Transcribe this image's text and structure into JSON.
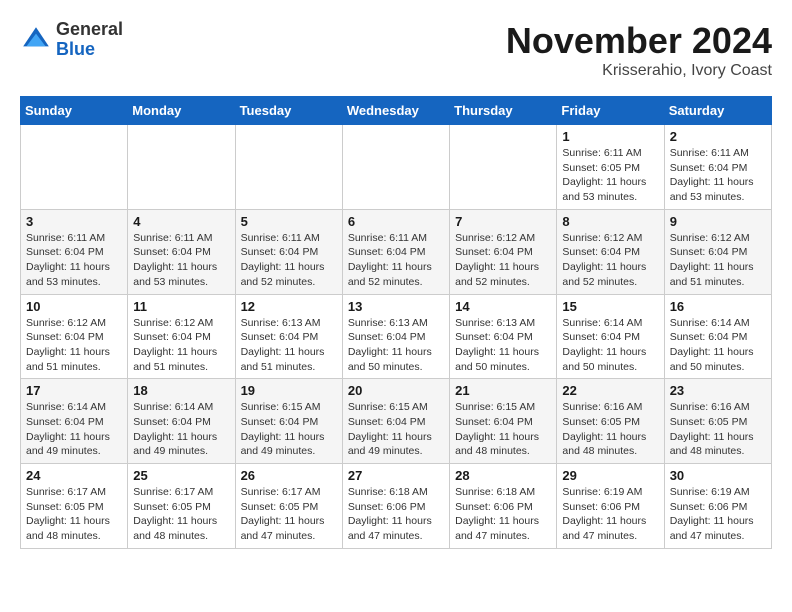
{
  "logo": {
    "line1": "General",
    "line2": "Blue"
  },
  "title": "November 2024",
  "subtitle": "Krisserahio, Ivory Coast",
  "weekdays": [
    "Sunday",
    "Monday",
    "Tuesday",
    "Wednesday",
    "Thursday",
    "Friday",
    "Saturday"
  ],
  "weeks": [
    [
      {
        "day": "",
        "info": ""
      },
      {
        "day": "",
        "info": ""
      },
      {
        "day": "",
        "info": ""
      },
      {
        "day": "",
        "info": ""
      },
      {
        "day": "",
        "info": ""
      },
      {
        "day": "1",
        "info": "Sunrise: 6:11 AM\nSunset: 6:05 PM\nDaylight: 11 hours and 53 minutes."
      },
      {
        "day": "2",
        "info": "Sunrise: 6:11 AM\nSunset: 6:04 PM\nDaylight: 11 hours and 53 minutes."
      }
    ],
    [
      {
        "day": "3",
        "info": "Sunrise: 6:11 AM\nSunset: 6:04 PM\nDaylight: 11 hours and 53 minutes."
      },
      {
        "day": "4",
        "info": "Sunrise: 6:11 AM\nSunset: 6:04 PM\nDaylight: 11 hours and 53 minutes."
      },
      {
        "day": "5",
        "info": "Sunrise: 6:11 AM\nSunset: 6:04 PM\nDaylight: 11 hours and 52 minutes."
      },
      {
        "day": "6",
        "info": "Sunrise: 6:11 AM\nSunset: 6:04 PM\nDaylight: 11 hours and 52 minutes."
      },
      {
        "day": "7",
        "info": "Sunrise: 6:12 AM\nSunset: 6:04 PM\nDaylight: 11 hours and 52 minutes."
      },
      {
        "day": "8",
        "info": "Sunrise: 6:12 AM\nSunset: 6:04 PM\nDaylight: 11 hours and 52 minutes."
      },
      {
        "day": "9",
        "info": "Sunrise: 6:12 AM\nSunset: 6:04 PM\nDaylight: 11 hours and 51 minutes."
      }
    ],
    [
      {
        "day": "10",
        "info": "Sunrise: 6:12 AM\nSunset: 6:04 PM\nDaylight: 11 hours and 51 minutes."
      },
      {
        "day": "11",
        "info": "Sunrise: 6:12 AM\nSunset: 6:04 PM\nDaylight: 11 hours and 51 minutes."
      },
      {
        "day": "12",
        "info": "Sunrise: 6:13 AM\nSunset: 6:04 PM\nDaylight: 11 hours and 51 minutes."
      },
      {
        "day": "13",
        "info": "Sunrise: 6:13 AM\nSunset: 6:04 PM\nDaylight: 11 hours and 50 minutes."
      },
      {
        "day": "14",
        "info": "Sunrise: 6:13 AM\nSunset: 6:04 PM\nDaylight: 11 hours and 50 minutes."
      },
      {
        "day": "15",
        "info": "Sunrise: 6:14 AM\nSunset: 6:04 PM\nDaylight: 11 hours and 50 minutes."
      },
      {
        "day": "16",
        "info": "Sunrise: 6:14 AM\nSunset: 6:04 PM\nDaylight: 11 hours and 50 minutes."
      }
    ],
    [
      {
        "day": "17",
        "info": "Sunrise: 6:14 AM\nSunset: 6:04 PM\nDaylight: 11 hours and 49 minutes."
      },
      {
        "day": "18",
        "info": "Sunrise: 6:14 AM\nSunset: 6:04 PM\nDaylight: 11 hours and 49 minutes."
      },
      {
        "day": "19",
        "info": "Sunrise: 6:15 AM\nSunset: 6:04 PM\nDaylight: 11 hours and 49 minutes."
      },
      {
        "day": "20",
        "info": "Sunrise: 6:15 AM\nSunset: 6:04 PM\nDaylight: 11 hours and 49 minutes."
      },
      {
        "day": "21",
        "info": "Sunrise: 6:15 AM\nSunset: 6:04 PM\nDaylight: 11 hours and 48 minutes."
      },
      {
        "day": "22",
        "info": "Sunrise: 6:16 AM\nSunset: 6:05 PM\nDaylight: 11 hours and 48 minutes."
      },
      {
        "day": "23",
        "info": "Sunrise: 6:16 AM\nSunset: 6:05 PM\nDaylight: 11 hours and 48 minutes."
      }
    ],
    [
      {
        "day": "24",
        "info": "Sunrise: 6:17 AM\nSunset: 6:05 PM\nDaylight: 11 hours and 48 minutes."
      },
      {
        "day": "25",
        "info": "Sunrise: 6:17 AM\nSunset: 6:05 PM\nDaylight: 11 hours and 48 minutes."
      },
      {
        "day": "26",
        "info": "Sunrise: 6:17 AM\nSunset: 6:05 PM\nDaylight: 11 hours and 47 minutes."
      },
      {
        "day": "27",
        "info": "Sunrise: 6:18 AM\nSunset: 6:06 PM\nDaylight: 11 hours and 47 minutes."
      },
      {
        "day": "28",
        "info": "Sunrise: 6:18 AM\nSunset: 6:06 PM\nDaylight: 11 hours and 47 minutes."
      },
      {
        "day": "29",
        "info": "Sunrise: 6:19 AM\nSunset: 6:06 PM\nDaylight: 11 hours and 47 minutes."
      },
      {
        "day": "30",
        "info": "Sunrise: 6:19 AM\nSunset: 6:06 PM\nDaylight: 11 hours and 47 minutes."
      }
    ]
  ]
}
